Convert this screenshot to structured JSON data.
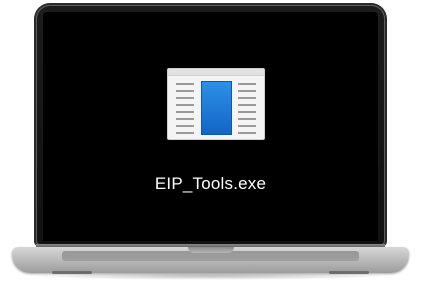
{
  "desktop": {
    "file": {
      "name": "EIP_Tools.exe",
      "icon": "application-window-icon",
      "icon_accent": "#1a73d9"
    }
  },
  "device": {
    "type": "laptop",
    "screen_color": "#000000",
    "body_color": "#c4c4c4"
  }
}
